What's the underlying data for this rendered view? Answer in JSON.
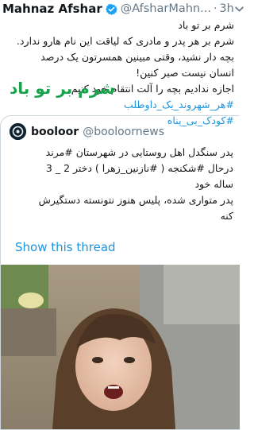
{
  "author": {
    "name": "Mahnaz Afshar",
    "handle": "@AfsharMahn...",
    "separator": "·",
    "time": "3h"
  },
  "tweet": {
    "lines": [
      "شرم بر تو باد",
      "شرم بر هر پدر و مادری که لیاقت این نام هارو ندارد.",
      "بچه دار نشید، وقتی مبینین همسرتون یک درصد",
      "انسان نیست صبر کنین!",
      "اجازه ندادیم  بچه را آلت انتقام خود کنیم."
    ],
    "hashtags": [
      "#هر_شهروند_یک_داوطلب",
      "#کودک_بی_پناه"
    ]
  },
  "overlay_title": "شرم بر تو باد",
  "quoted": {
    "name": "booloor",
    "handle": "@booloornews",
    "lines": [
      "پدر سنگدل اهل روستایی در شهرستان #مرند",
      "درحال #شکنجه ( #نازنین_زهرا ) دختر 2 _ 3",
      "ساله خود",
      "پدر متواری شده، پلیس هنوز نتونسته دستگیرش",
      "کنه"
    ],
    "show_thread": "Show this thread"
  },
  "colors": {
    "accent": "#1b95e0",
    "overlay_green": "#17a34a",
    "muted": "#657786"
  },
  "icons": {
    "verified": "verified-badge-icon",
    "menu": "chevron-down-icon"
  }
}
